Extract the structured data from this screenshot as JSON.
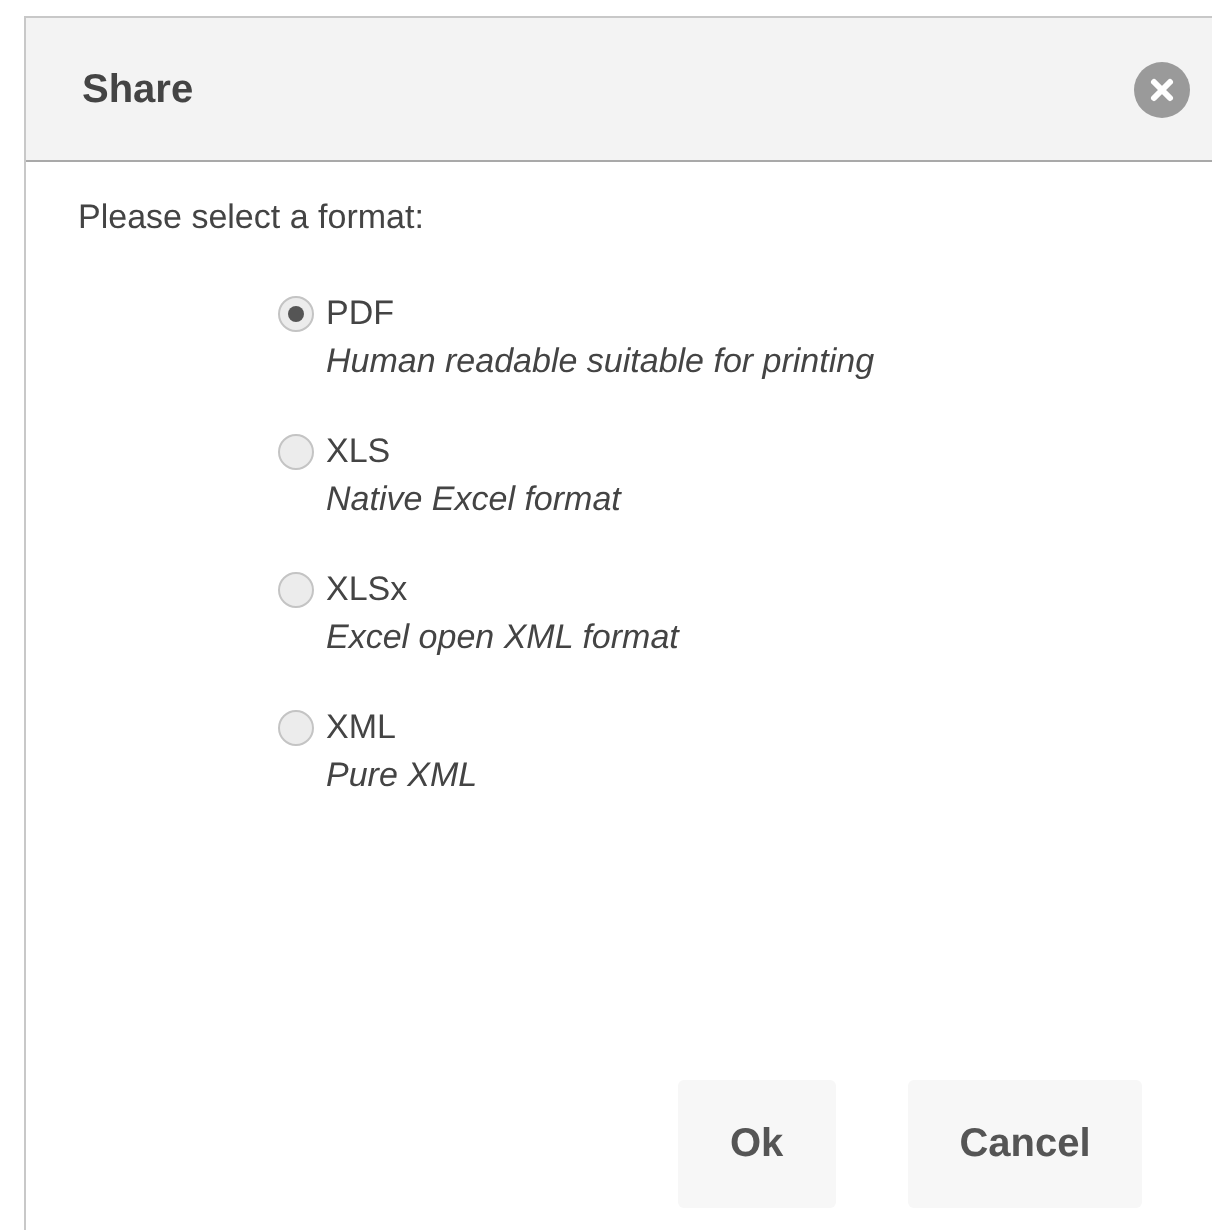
{
  "dialog": {
    "title": "Share"
  },
  "prompt": "Please select a format:",
  "formats": [
    {
      "label": "PDF",
      "description": "Human readable suitable for printing",
      "selected": true
    },
    {
      "label": "XLS",
      "description": "Native Excel format",
      "selected": false
    },
    {
      "label": "XLSx",
      "description": "Excel open XML format",
      "selected": false
    },
    {
      "label": "XML",
      "description": "Pure XML",
      "selected": false
    }
  ],
  "buttons": [
    "Ok",
    "Cancel"
  ]
}
